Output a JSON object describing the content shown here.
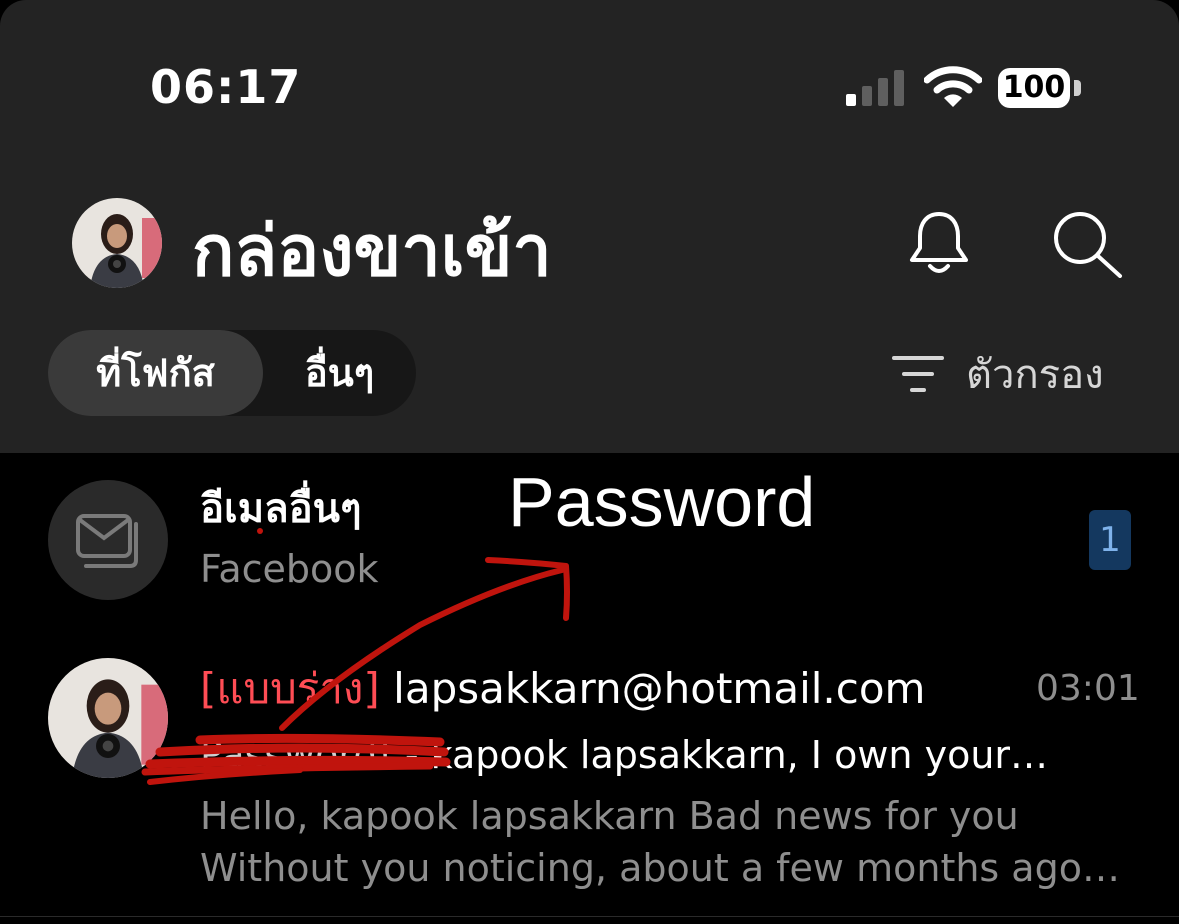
{
  "status_bar": {
    "time": "06:17",
    "battery": "100"
  },
  "header": {
    "title": "กล่องขาเข้า"
  },
  "tabs": {
    "focused": "ที่โฟกัส",
    "other": "อื่นๆ",
    "filter_label": "ตัวกรอง"
  },
  "other_mail_row": {
    "title": "อีเมลอื่นๆ",
    "subtitle": "Facebook",
    "count": "1"
  },
  "annotation": {
    "text": "Password",
    "color": "#c0140d"
  },
  "message": {
    "draft_label": "[แบบร่าง]",
    "sender": "lapsakkarn@hotmail.com",
    "time": "03:01",
    "subject_hidden": "Password!",
    "subject": " - kapook lapsakkarn, I own your…",
    "preview_line1": "Hello, kapook lapsakkarn Bad news for you",
    "preview_line2": "Without you noticing, about a few months ago…"
  },
  "colors": {
    "header_bg": "#232323",
    "list_bg": "#000000",
    "draft_red": "#ff4d55",
    "badge_bg": "#14385f"
  }
}
